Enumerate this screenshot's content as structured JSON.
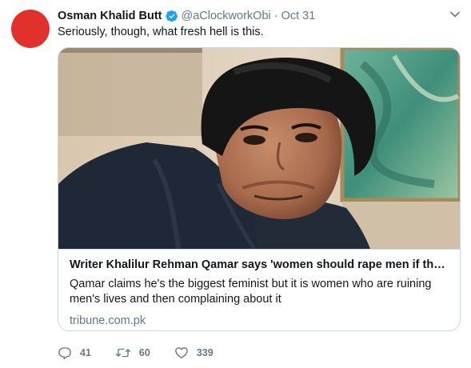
{
  "tweet": {
    "author_name": "Osman Khalid Butt",
    "handle": "@aClockworkObi",
    "separator": "·",
    "date": "Oct 31",
    "text": "Seriously, though, what fresh hell is this."
  },
  "card": {
    "title": "Writer Khalilur Rehman Qamar says 'women should rape men if they ...",
    "description": "Qamar claims he's the biggest feminist but it is women who are ruining men's lives and then complaining about it",
    "domain": "tribune.com.pk"
  },
  "actions": {
    "replies": "41",
    "retweets": "60",
    "likes": "339"
  },
  "colors": {
    "avatar": "#e0312c",
    "verified": "#1da1f2",
    "secondary_text": "#657786",
    "border": "#ccd6dd"
  },
  "icons": [
    "verified-badge-icon",
    "chevron-down-icon",
    "reply-icon",
    "retweet-icon",
    "heart-icon"
  ]
}
